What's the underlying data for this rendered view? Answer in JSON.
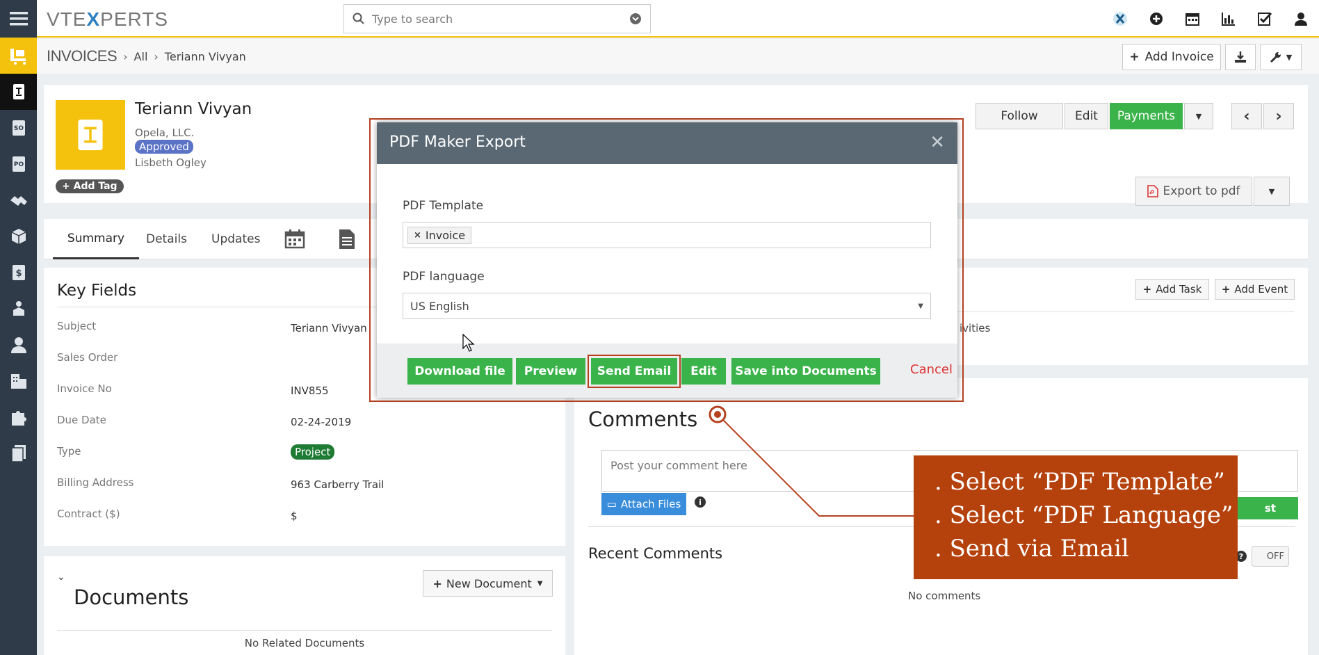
{
  "app": {
    "logo_prefix": "VTE",
    "logo_x": "X",
    "logo_suffix": "PERTS",
    "search_placeholder": "Type to search"
  },
  "breadcrumb": {
    "module": "INVOICES",
    "all": "All",
    "record": "Teriann Vivyan"
  },
  "header_actions": {
    "add_invoice": "Add Invoice"
  },
  "record": {
    "title": "Teriann Vivyan",
    "organization": "Opela, LLC.",
    "status": "Approved",
    "assigned": "Lisbeth Ogley",
    "add_tag": "Add Tag",
    "follow": "Follow",
    "edit": "Edit",
    "payments": "Payments",
    "export_pdf": "Export to pdf"
  },
  "tabs": {
    "summary": "Summary",
    "details": "Details",
    "updates": "Updates"
  },
  "key_fields": {
    "title": "Key Fields",
    "rows": [
      {
        "label": "Subject",
        "value": "Teriann Vivyan"
      },
      {
        "label": "Sales Order",
        "value": ""
      },
      {
        "label": "Invoice No",
        "value": "INV855"
      },
      {
        "label": "Due Date",
        "value": "02-24-2019"
      },
      {
        "label": "Type",
        "value": "Project"
      },
      {
        "label": "Billing Address",
        "value": "963 Carberry Trail"
      },
      {
        "label": "Contract ($)",
        "value": "$"
      }
    ]
  },
  "activities": {
    "add_task": "Add Task",
    "add_event": "Add Event",
    "partial_text": "ivities"
  },
  "documents": {
    "title": "Documents",
    "new_document": "New Document",
    "empty": "No Related Documents"
  },
  "comments": {
    "title": "Comments",
    "placeholder": "Post your comment here",
    "attach": "Attach Files",
    "post_partial": "st",
    "recent_title": "Recent Comments",
    "toggle": "OFF",
    "empty": "No comments"
  },
  "modal": {
    "title": "PDF Maker Export",
    "template_label": "PDF Template",
    "template_value": "Invoice",
    "language_label": "PDF language",
    "language_value": "US English",
    "buttons": {
      "download": "Download file",
      "preview": "Preview",
      "send_email": "Send Email",
      "edit": "Edit",
      "save_docs": "Save into Documents",
      "cancel": "Cancel"
    }
  },
  "callout": {
    "line1": ". Select “PDF Template”",
    "line2": ". Select “PDF Language”",
    "line3": ". Send via Email",
    "color": "#b5410c"
  }
}
